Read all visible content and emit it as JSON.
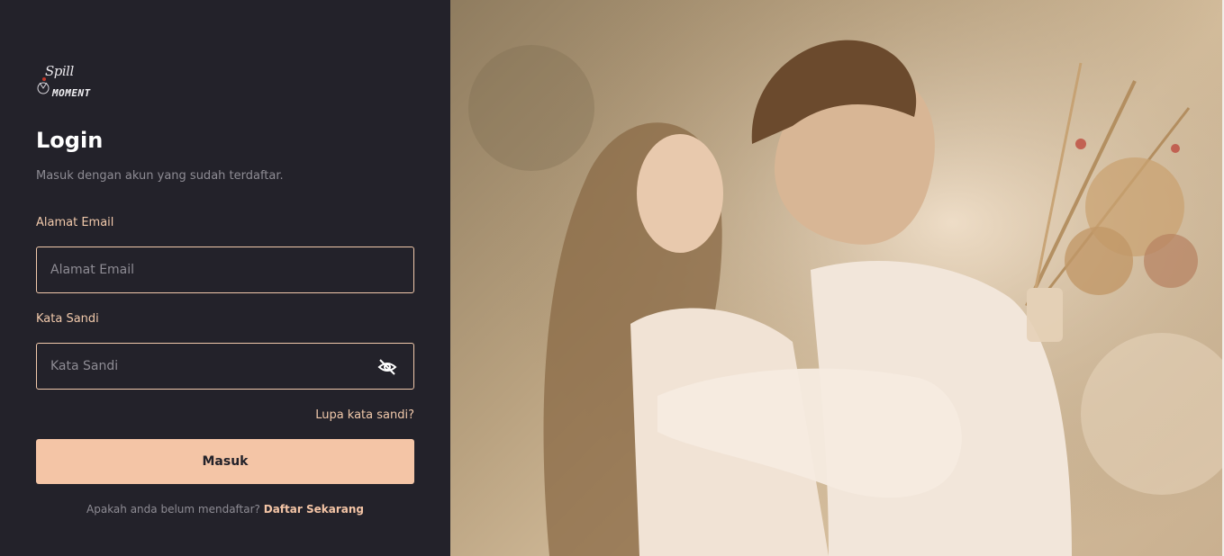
{
  "brand": {
    "script": "Spill",
    "word": "MOMENT"
  },
  "form": {
    "title": "Login",
    "subtitle": "Masuk dengan akun yang sudah terdaftar.",
    "email_label": "Alamat Email",
    "email_placeholder": "Alamat Email",
    "email_value": "",
    "password_label": "Kata Sandi",
    "password_placeholder": "Kata Sandi",
    "password_value": "",
    "forgot_label": "Lupa kata sandi?",
    "submit_label": "Masuk",
    "signup_prompt": "Apakah anda belum mendaftar?",
    "signup_link": "Daftar Sekarang"
  },
  "icons": {
    "logo": "spill-moment-logo",
    "password_toggle": "eye-slash-icon"
  },
  "colors": {
    "panel_bg": "#23222a",
    "accent": "#f4c5a6",
    "label": "#f1c9ab",
    "muted": "#8e8c94"
  }
}
